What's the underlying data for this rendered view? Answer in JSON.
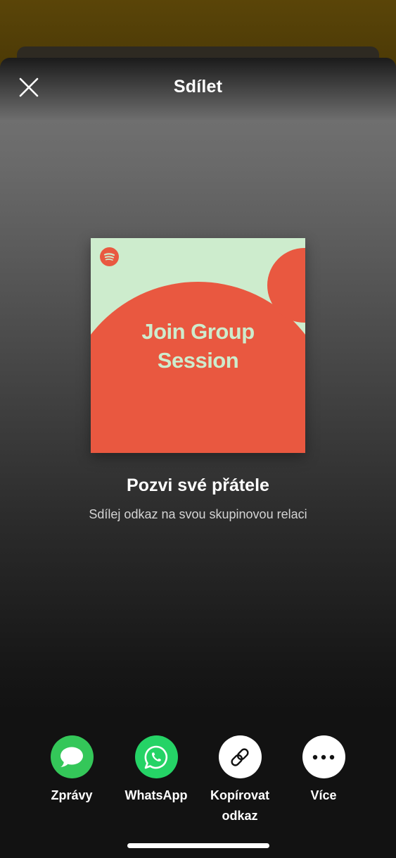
{
  "header": {
    "title": "Sdílet",
    "close_icon": "close-icon"
  },
  "cover": {
    "title": "Join Group Session",
    "logo_icon": "spotify-logo-icon",
    "colors": {
      "background": "#cdeccd",
      "accent": "#e95840"
    }
  },
  "invite": {
    "title": "Pozvi své přátele",
    "subtitle": "Sdílej odkaz na svou skupinovou relaci"
  },
  "share_options": [
    {
      "label": "Zprávy",
      "icon": "messages-icon",
      "color": "#34c759"
    },
    {
      "label": "WhatsApp",
      "icon": "whatsapp-icon",
      "color": "#25d366"
    },
    {
      "label": "Kopírovat odkaz",
      "icon": "link-icon",
      "color": "#ffffff"
    },
    {
      "label": "Více",
      "icon": "more-icon",
      "color": "#ffffff"
    }
  ]
}
